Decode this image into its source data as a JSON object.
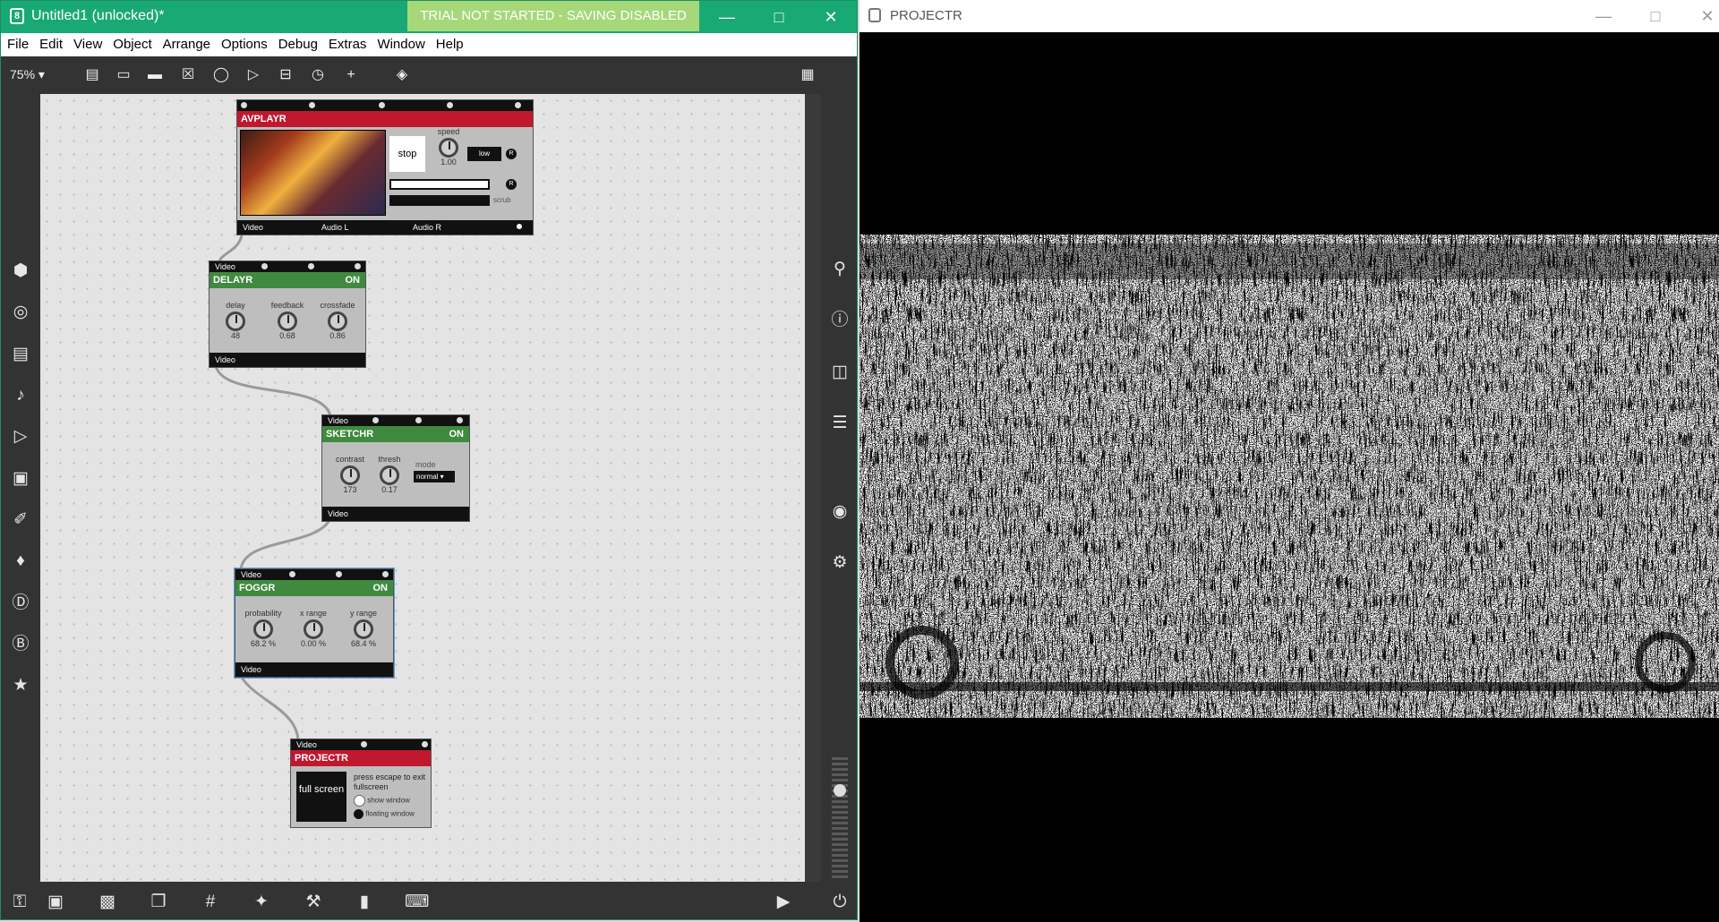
{
  "max": {
    "title": "Untitled1 (unlocked)*",
    "trial_banner": "TRIAL NOT STARTED - SAVING DISABLED",
    "menu": [
      "File",
      "Edit",
      "View",
      "Object",
      "Arrange",
      "Options",
      "Debug",
      "Extras",
      "Window",
      "Help"
    ],
    "zoom": "75%"
  },
  "modules": {
    "avplayr": {
      "name": "AVPLAYR",
      "stop_label": "stop",
      "speed_label": "speed",
      "speed_value": "1.00",
      "low_label": "low",
      "r_label": "R",
      "scrub_label": "scrub",
      "outlets": [
        "Video",
        "Audio L",
        "Audio R"
      ]
    },
    "delayr": {
      "inlet": "Video",
      "name": "DELAYR",
      "state": "ON",
      "knobs": [
        {
          "label": "delay",
          "value": "48"
        },
        {
          "label": "feedback",
          "value": "0.68"
        },
        {
          "label": "crossfade",
          "value": "0.86"
        }
      ],
      "outlet": "Video"
    },
    "sketchr": {
      "inlet": "Video",
      "name": "SKETCHR",
      "state": "ON",
      "knobs": [
        {
          "label": "contrast",
          "value": "173"
        },
        {
          "label": "thresh",
          "value": "0.17"
        }
      ],
      "mode_label": "mode",
      "mode_value": "normal",
      "outlet": "Video"
    },
    "foggr": {
      "inlet": "Video",
      "name": "FOGGR",
      "state": "ON",
      "knobs": [
        {
          "label": "probability",
          "value": "68.2 %"
        },
        {
          "label": "x range",
          "value": "0.00 %"
        },
        {
          "label": "y range",
          "value": "68.4 %"
        }
      ],
      "outlet": "Video"
    },
    "projectr": {
      "inlet": "Video",
      "name": "PROJECTR",
      "fullscreen_label": "full screen",
      "escape_text": "press escape to exit fullscreen",
      "show_window": "show window",
      "floating_window": "floating window"
    }
  },
  "projectr_window": {
    "title": "PROJECTR"
  },
  "colors": {
    "titlebar": "#19a974",
    "red_header": "#c0182e",
    "green_header": "#3f8a3f",
    "trial": "#a6d87a"
  }
}
